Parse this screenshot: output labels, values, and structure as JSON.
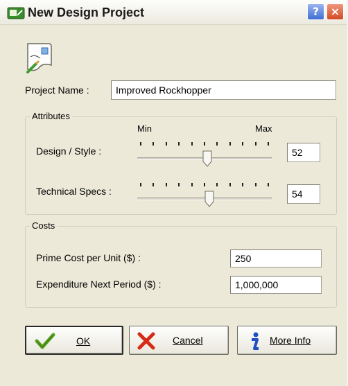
{
  "window": {
    "title": "New Design Project",
    "icon": "design-project-icon",
    "help_button": "?",
    "close_button": "×"
  },
  "project": {
    "label": "Project Name :",
    "value": "Improved Rockhopper"
  },
  "attributes": {
    "legend": "Attributes",
    "min_label": "Min",
    "max_label": "Max",
    "design": {
      "label": "Design / Style :",
      "value": "52",
      "slider_fraction": 0.52
    },
    "technical": {
      "label": "Technical Specs :",
      "value": "54",
      "slider_fraction": 0.54
    },
    "tick_count": 11
  },
  "costs": {
    "legend": "Costs",
    "prime": {
      "label": "Prime Cost per Unit ($) :",
      "value": "250"
    },
    "expenditure": {
      "label": "Expenditure Next Period ($) :",
      "value": "1,000,000"
    }
  },
  "buttons": {
    "ok": {
      "label": "OK",
      "icon": "check-icon"
    },
    "cancel": {
      "label": "Cancel",
      "icon": "x-icon"
    },
    "more_info": {
      "label": "More Info",
      "icon": "info-icon"
    }
  },
  "colors": {
    "dialog_bg": "#ece9d8",
    "ok_check": "#5aa11f",
    "cancel_x": "#d62a17",
    "info_blue": "#1f4fc0"
  }
}
